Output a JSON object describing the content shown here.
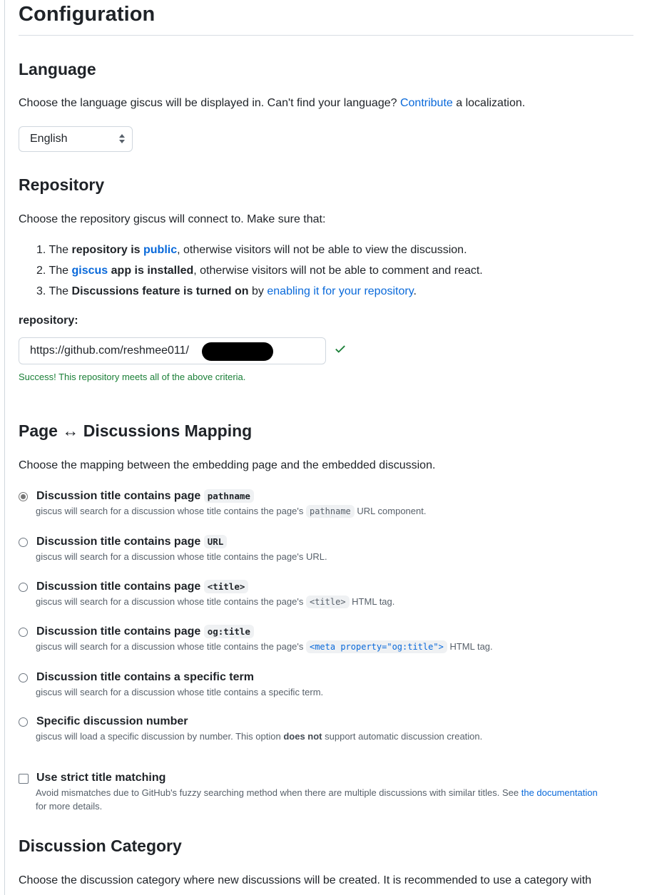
{
  "page": {
    "title": "Configuration"
  },
  "language": {
    "heading": "Language",
    "desc_prefix": "Choose the language giscus will be displayed in. Can't find your language?",
    "desc_link": "Contribute",
    "desc_suffix": "a localization.",
    "selected": "English"
  },
  "repository": {
    "heading": "Repository",
    "intro": "Choose the repository giscus will connect to. Make sure that:",
    "criteria": [
      {
        "num": "1.",
        "pre": "The ",
        "bold": "repository is ",
        "link": "public",
        "post": ", otherwise visitors will not be able to view the discussion."
      },
      {
        "num": "2.",
        "pre": "The ",
        "link": "giscus",
        "bold": " app is installed",
        "post": ", otherwise visitors will not be able to comment and react."
      },
      {
        "num": "3.",
        "pre": "The ",
        "bold": "Discussions feature is turned on",
        "mid": " by ",
        "link": "enabling it for your repository",
        "post": "."
      }
    ],
    "field_label": "repository:",
    "field_value": "https://github.com/reshmee011/",
    "status_icon": "check-icon",
    "success_message": "Success! This repository meets all of the above criteria.",
    "status_color": "#1a7f37"
  },
  "mapping": {
    "heading": "Page ↔ Discussions Mapping",
    "intro": "Choose the mapping between the embedding page and the embedded discussion.",
    "options": [
      {
        "title": "Discussion title contains page",
        "code": "pathname",
        "selected": true,
        "desc_pre": "giscus will search for a discussion whose title contains the page's",
        "desc_code": "pathname",
        "desc_post": "URL component."
      },
      {
        "title": "Discussion title contains page",
        "code": "URL",
        "selected": false,
        "desc_pre": "giscus will search for a discussion whose title contains the page's URL.",
        "desc_code": "",
        "desc_post": ""
      },
      {
        "title": "Discussion title contains page",
        "code": "<title>",
        "selected": false,
        "desc_pre": "giscus will search for a discussion whose title contains the page's",
        "desc_code": "<title>",
        "desc_post": "HTML tag."
      },
      {
        "title": "Discussion title contains page",
        "code": "og:title",
        "selected": false,
        "desc_pre": "giscus will search for a discussion whose title contains the page's",
        "desc_code": "<meta property=\"og:title\">",
        "desc_post": "HTML tag."
      },
      {
        "title": "Discussion title contains a specific term",
        "code": "",
        "selected": false,
        "desc_pre": "giscus will search for a discussion whose title contains a specific term.",
        "desc_code": "",
        "desc_post": ""
      },
      {
        "title": "Specific discussion number",
        "code": "",
        "selected": false,
        "desc_pre": "giscus will load a specific discussion by number. This option",
        "desc_bold": "does not",
        "desc_post": "support automatic discussion creation."
      }
    ],
    "strict": {
      "label": "Use strict title matching",
      "checked": false,
      "desc_pre": "Avoid mismatches due to GitHub's fuzzy searching method when there are multiple discussions with similar titles. See",
      "desc_link": "the documentation",
      "desc_post": "for more details."
    }
  },
  "category": {
    "heading": "Discussion Category",
    "intro": "Choose the discussion category where new discussions will be created. It is recommended to use a category with"
  }
}
